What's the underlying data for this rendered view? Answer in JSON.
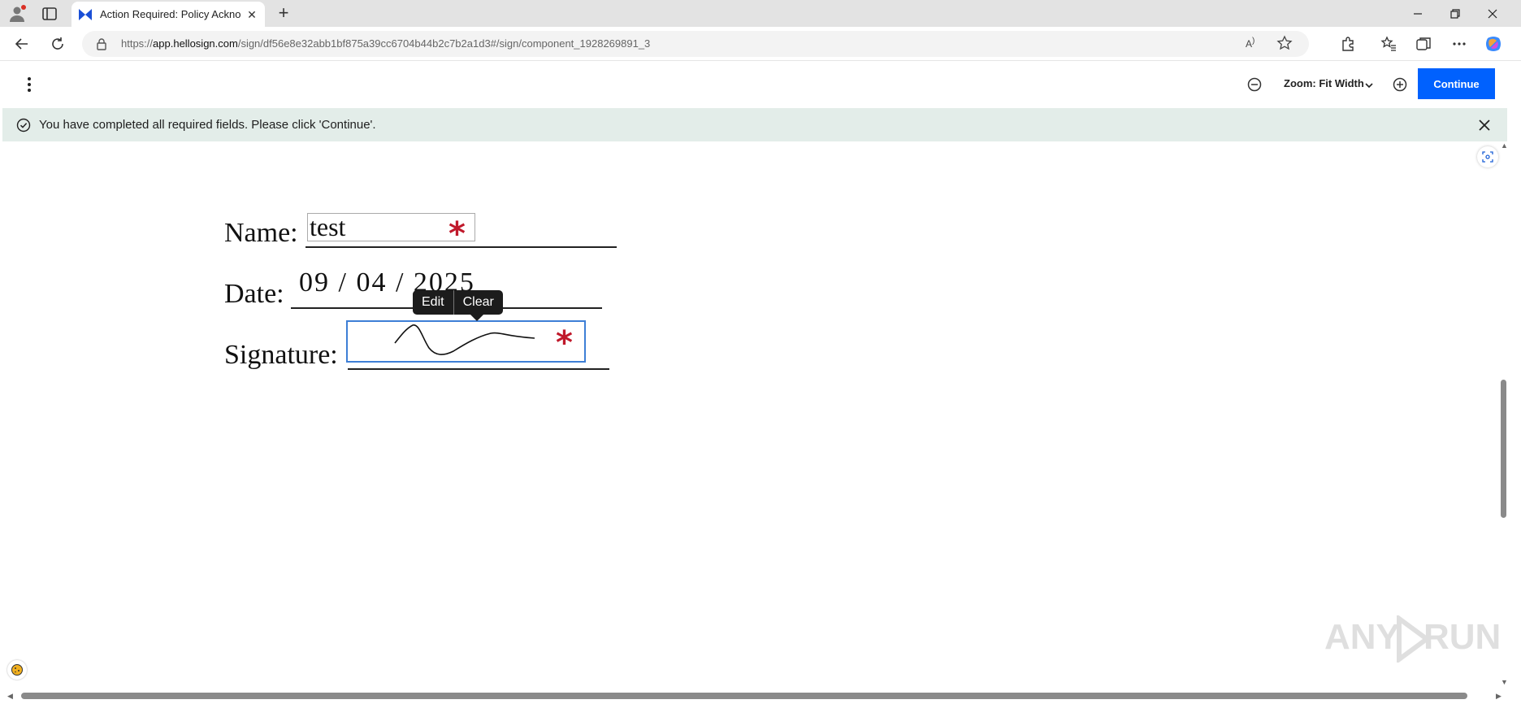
{
  "browser": {
    "tab_title": "Action Required: Policy Acknowle",
    "url_prefix": "https://",
    "url_host": "app.hellosign.com",
    "url_path": "/sign/df56e8e32abb1bf875a39cc6704b44b2c7b2a1d3#/sign/component_1928269891_3",
    "read_aloud_label": "A"
  },
  "header": {
    "zoom_label": "Zoom: Fit Width",
    "continue_label": "Continue"
  },
  "banner": {
    "message": "You have completed all required fields. Please click 'Continue'."
  },
  "document": {
    "name_label": "Name:",
    "name_value": "test",
    "date_label": "Date:",
    "date_value": "09 / 04 / 2025",
    "signature_label": "Signature:",
    "required_mark": "*"
  },
  "tooltip": {
    "edit_label": "Edit",
    "clear_label": "Clear"
  },
  "watermark": {
    "text_left": "ANY",
    "text_right": "RUN"
  },
  "colors": {
    "accent": "#0061fe",
    "banner_bg": "#e3ede9",
    "required": "#c0192b",
    "signature_border": "#3e7fd6"
  }
}
